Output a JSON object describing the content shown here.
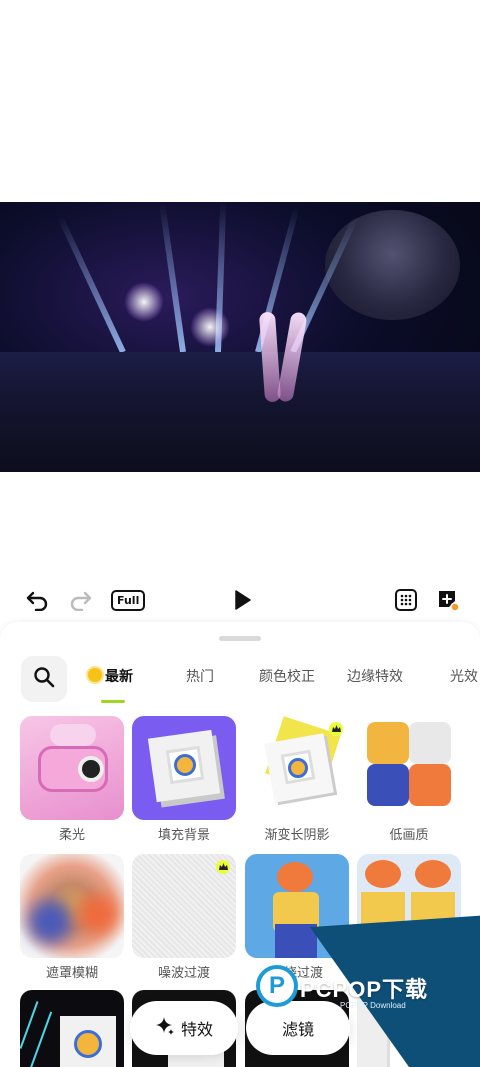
{
  "toolbar": {
    "undo_icon": "undo-icon",
    "redo_icon": "redo-icon",
    "full_label": "Full",
    "play_icon": "play-icon",
    "grid_icon": "grid-icon",
    "add_sticker_icon": "add-sticker-icon"
  },
  "panel": {
    "search_icon": "search-icon",
    "tabs": [
      {
        "label": "最新",
        "active": true,
        "icon": "sun-emoji-icon"
      },
      {
        "label": "热门",
        "active": false
      },
      {
        "label": "颜色校正",
        "active": false
      },
      {
        "label": "边缘特效",
        "active": false
      },
      {
        "label": "光效",
        "active": false
      }
    ],
    "effects": [
      {
        "label": "柔光",
        "premium": false
      },
      {
        "label": "填充背景",
        "premium": false
      },
      {
        "label": "渐变长阴影",
        "premium": true
      },
      {
        "label": "低画质",
        "premium": false
      },
      {
        "label": "遮罩模糊",
        "premium": false
      },
      {
        "label": "噪波过渡",
        "premium": true
      },
      {
        "label": "燃烧过渡",
        "premium": false
      },
      {
        "label": "",
        "premium": false
      }
    ]
  },
  "bottom_tabs": {
    "effects_label": "特效",
    "effects_icon": "sparkle-icon",
    "filter_label": "滤镜"
  },
  "watermark": {
    "text": "PCPOP下载",
    "sub": "PCPOP Download",
    "logo_letter": "P"
  },
  "colors": {
    "accent": "#9cd81f",
    "crown": "#e8ff3a",
    "sticker_badge": "#f39a2c"
  }
}
